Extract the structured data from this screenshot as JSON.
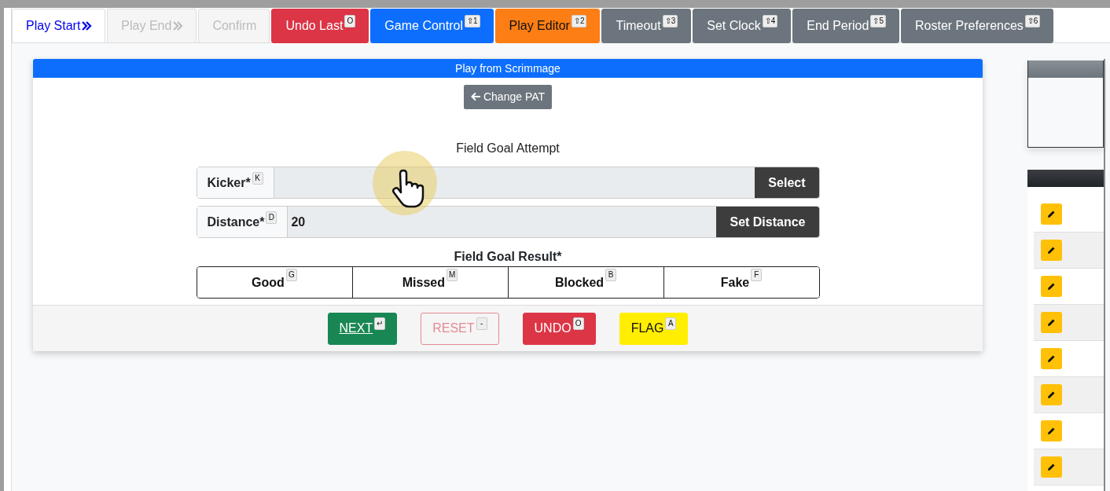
{
  "toolbar": [
    {
      "label": "Play Start",
      "selected": true,
      "disabled": false,
      "chevrons": true
    },
    {
      "label": "Play End",
      "selected": false,
      "disabled": true,
      "chevrons": true
    },
    {
      "label": "Confirm",
      "selected": false,
      "disabled": true,
      "chevrons": false
    },
    {
      "label": "Undo Last",
      "hotkey": "O",
      "selected": false,
      "disabled": false,
      "chevrons": false,
      "color": "#dc3545"
    },
    {
      "label": "Game Control",
      "hotkey": "⇧1",
      "selected": false,
      "disabled": false,
      "chevrons": false,
      "color": "#0d6efd"
    },
    {
      "label": "Play Editor",
      "hotkey": "⇧2",
      "selected": false,
      "disabled": false,
      "chevrons": false,
      "color": "#fd7e14"
    },
    {
      "label": "Timeout",
      "hotkey": "⇧3",
      "selected": false,
      "disabled": false,
      "chevrons": false,
      "color": "#6c757d"
    },
    {
      "label": "Set Clock",
      "hotkey": "⇧4",
      "selected": false,
      "disabled": false,
      "chevrons": false,
      "color": "#6c757d"
    },
    {
      "label": "End Period",
      "hotkey": "⇧5",
      "selected": false,
      "disabled": false,
      "chevrons": false,
      "color": "#6c757d"
    },
    {
      "label": "Roster Preferences",
      "hotkey": "⇧6",
      "selected": false,
      "disabled": false,
      "chevrons": false,
      "color": "#6c757d"
    }
  ],
  "card": {
    "title": "Play from Scrimmage",
    "change_button": "Change PAT",
    "section_title": "Field Goal Attempt",
    "fields": [
      {
        "label": "Kicker*",
        "hotkey": "K",
        "button": "Select"
      },
      {
        "label": "Distance*",
        "hotkey": "D",
        "value": "20",
        "button": "Set Distance"
      }
    ],
    "result": {
      "label": "Field Goal Result*",
      "options": [
        {
          "label": "Good",
          "hotkey": "G",
          "selected": false
        },
        {
          "label": "Missed",
          "hotkey": "M",
          "selected": false
        },
        {
          "label": "Blocked",
          "hotkey": "B",
          "selected": false
        },
        {
          "label": "Fake",
          "hotkey": "F",
          "selected": false
        }
      ]
    },
    "footer_buttons": [
      {
        "label": "NEXT",
        "hotkey": "↵",
        "kind": "solid",
        "color": "#198754"
      },
      {
        "label": "RESET",
        "hotkey": "-",
        "kind": "outline",
        "color": "#e58a94"
      },
      {
        "label": "UNDO",
        "hotkey": "O",
        "kind": "solid",
        "color": "#dc3545"
      },
      {
        "label": "FLAG",
        "hotkey": "A",
        "kind": "solid",
        "color": "#ffee00"
      }
    ]
  },
  "side_list": {
    "rows": [
      {
        "kind": "edit"
      },
      {
        "kind": "edit"
      },
      {
        "kind": "edit"
      },
      {
        "kind": "edit"
      },
      {
        "kind": "edit"
      },
      {
        "kind": "edit"
      },
      {
        "kind": "edit"
      },
      {
        "kind": "edit"
      }
    ]
  }
}
